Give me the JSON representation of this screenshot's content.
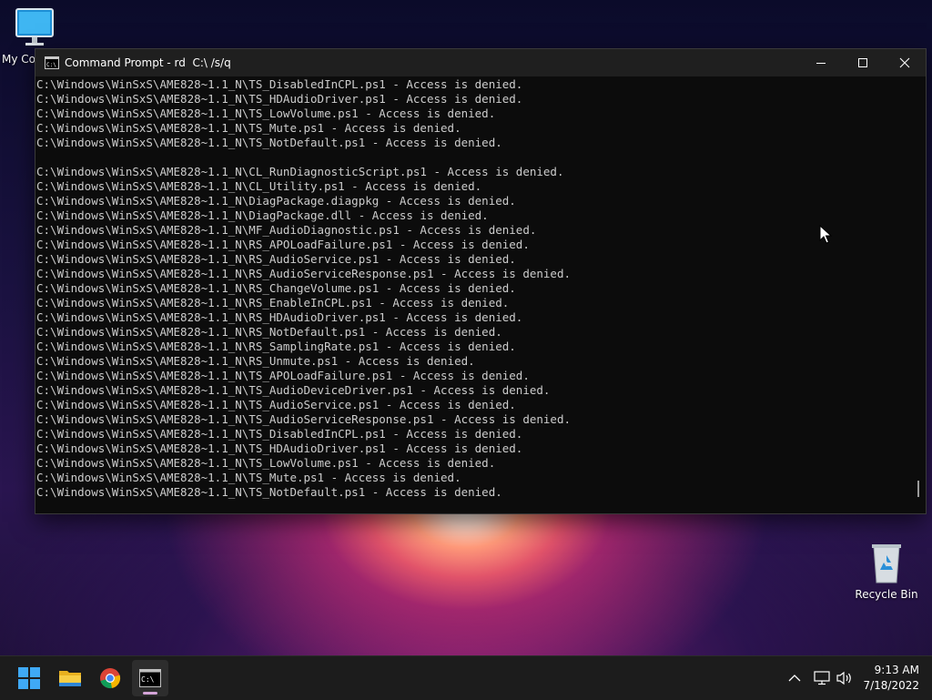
{
  "desktop": {
    "icons": [
      {
        "label": "My Co"
      },
      {
        "label": "Recycle Bin"
      }
    ]
  },
  "window": {
    "title": "Command Prompt - rd  C:\\ /s/q",
    "controls": {
      "minimize": "minimize-icon",
      "maximize": "maximize-icon",
      "close": "close-icon"
    }
  },
  "console": {
    "lines": [
      "C:\\Windows\\WinSxS\\AME828~1.1_N\\TS_DisabledInCPL.ps1 - Access is denied.",
      "C:\\Windows\\WinSxS\\AME828~1.1_N\\TS_HDAudioDriver.ps1 - Access is denied.",
      "C:\\Windows\\WinSxS\\AME828~1.1_N\\TS_LowVolume.ps1 - Access is denied.",
      "C:\\Windows\\WinSxS\\AME828~1.1_N\\TS_Mute.ps1 - Access is denied.",
      "C:\\Windows\\WinSxS\\AME828~1.1_N\\TS_NotDefault.ps1 - Access is denied.",
      "",
      "C:\\Windows\\WinSxS\\AME828~1.1_N\\CL_RunDiagnosticScript.ps1 - Access is denied.",
      "C:\\Windows\\WinSxS\\AME828~1.1_N\\CL_Utility.ps1 - Access is denied.",
      "C:\\Windows\\WinSxS\\AME828~1.1_N\\DiagPackage.diagpkg - Access is denied.",
      "C:\\Windows\\WinSxS\\AME828~1.1_N\\DiagPackage.dll - Access is denied.",
      "C:\\Windows\\WinSxS\\AME828~1.1_N\\MF_AudioDiagnostic.ps1 - Access is denied.",
      "C:\\Windows\\WinSxS\\AME828~1.1_N\\RS_APOLoadFailure.ps1 - Access is denied.",
      "C:\\Windows\\WinSxS\\AME828~1.1_N\\RS_AudioService.ps1 - Access is denied.",
      "C:\\Windows\\WinSxS\\AME828~1.1_N\\RS_AudioServiceResponse.ps1 - Access is denied.",
      "C:\\Windows\\WinSxS\\AME828~1.1_N\\RS_ChangeVolume.ps1 - Access is denied.",
      "C:\\Windows\\WinSxS\\AME828~1.1_N\\RS_EnableInCPL.ps1 - Access is denied.",
      "C:\\Windows\\WinSxS\\AME828~1.1_N\\RS_HDAudioDriver.ps1 - Access is denied.",
      "C:\\Windows\\WinSxS\\AME828~1.1_N\\RS_NotDefault.ps1 - Access is denied.",
      "C:\\Windows\\WinSxS\\AME828~1.1_N\\RS_SamplingRate.ps1 - Access is denied.",
      "C:\\Windows\\WinSxS\\AME828~1.1_N\\RS_Unmute.ps1 - Access is denied.",
      "C:\\Windows\\WinSxS\\AME828~1.1_N\\TS_APOLoadFailure.ps1 - Access is denied.",
      "C:\\Windows\\WinSxS\\AME828~1.1_N\\TS_AudioDeviceDriver.ps1 - Access is denied.",
      "C:\\Windows\\WinSxS\\AME828~1.1_N\\TS_AudioService.ps1 - Access is denied.",
      "C:\\Windows\\WinSxS\\AME828~1.1_N\\TS_AudioServiceResponse.ps1 - Access is denied.",
      "C:\\Windows\\WinSxS\\AME828~1.1_N\\TS_DisabledInCPL.ps1 - Access is denied.",
      "C:\\Windows\\WinSxS\\AME828~1.1_N\\TS_HDAudioDriver.ps1 - Access is denied.",
      "C:\\Windows\\WinSxS\\AME828~1.1_N\\TS_LowVolume.ps1 - Access is denied.",
      "C:\\Windows\\WinSxS\\AME828~1.1_N\\TS_Mute.ps1 - Access is denied.",
      "C:\\Windows\\WinSxS\\AME828~1.1_N\\TS_NotDefault.ps1 - Access is denied."
    ]
  },
  "taskbar": {
    "apps": [
      "start-icon",
      "file-explorer-icon",
      "chrome-icon",
      "terminal-icon"
    ],
    "tray": [
      "chevron-up-icon",
      "network-icon",
      "volume-icon"
    ],
    "clock": {
      "time": "9:13 AM",
      "date": "7/18/2022"
    }
  },
  "colors": {
    "console_bg": "#0c0c0c",
    "console_text": "#cccccc",
    "titlebar_bg": "#1f1f1f",
    "taskbar_bg": "#1c1c1c"
  }
}
